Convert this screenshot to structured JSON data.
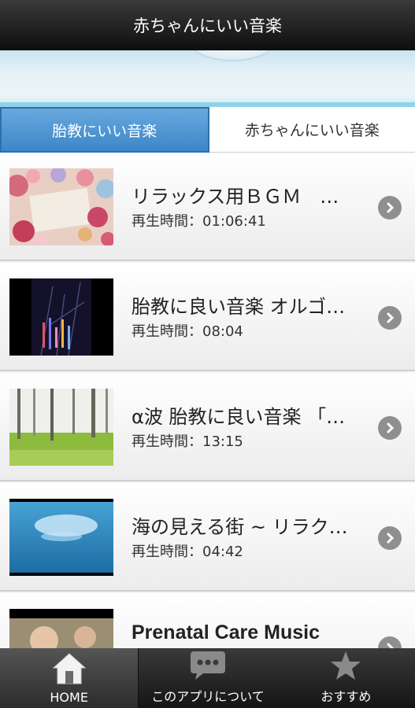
{
  "header": {
    "title": "赤ちゃんにいい音楽"
  },
  "tabs": [
    {
      "label": "胎教にいい音楽",
      "active": true
    },
    {
      "label": "赤ちゃんにいい音楽",
      "active": false
    }
  ],
  "list": {
    "duration_prefix": "再生時間：",
    "items": [
      {
        "title": "リラックス用ＢＧＭ　…",
        "duration": "01:06:41",
        "thumb": "flowers"
      },
      {
        "title": "胎教に良い音楽 オルゴ…",
        "duration": "08:04",
        "thumb": "lights"
      },
      {
        "title": "α波 胎教に良い音楽 「…",
        "duration": "13:15",
        "thumb": "forest"
      },
      {
        "title": "海の見える街 ~ リラク…",
        "duration": "04:42",
        "thumb": "sea"
      },
      {
        "title": "Prenatal Care Music",
        "duration": "",
        "thumb": "painting"
      }
    ]
  },
  "bottom_nav": [
    {
      "label": "HOME",
      "icon": "home-icon",
      "active": true
    },
    {
      "label": "このアプリについて",
      "icon": "chat-bubble-icon",
      "active": false
    },
    {
      "label": "おすすめ",
      "icon": "star-icon",
      "active": false
    }
  ],
  "colors": {
    "tab_active": "#3c86c8",
    "bar_dark": "#1a1a1a",
    "arrow": "#8f8f8f"
  }
}
